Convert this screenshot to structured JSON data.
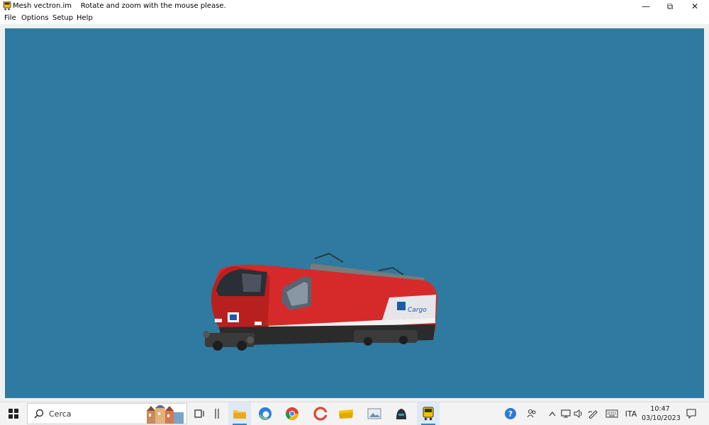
{
  "window": {
    "title": "Mesh vectron.im",
    "subtitle": "Rotate and zoom with the mouse please.",
    "controls": {
      "minimize": "—",
      "restore": "⧉",
      "close": "✕"
    }
  },
  "menu": {
    "items": [
      "File",
      "Options",
      "Setup",
      "Help"
    ]
  },
  "viewport": {
    "background": "#2e7aa0",
    "model": {
      "logo_text": "Cargo",
      "body_color": "#d62a2a"
    }
  },
  "taskbar": {
    "search_placeholder": "Cerca",
    "language": "ITA",
    "time": "10:47",
    "date": "03/10/2023",
    "apps": [
      "task-view",
      "widgets",
      "file-explorer",
      "edge",
      "chrome",
      "ccleaner",
      "folder",
      "image-viewer",
      "dark-app",
      "train-app"
    ]
  }
}
